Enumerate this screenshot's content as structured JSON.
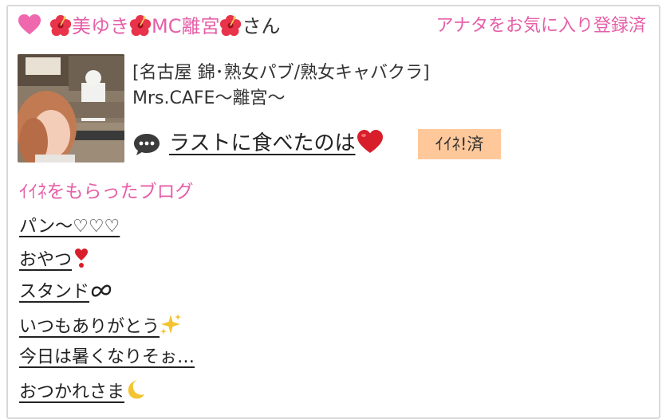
{
  "header": {
    "name_part1": "美ゆき",
    "name_part2": "MC離宮",
    "name_suffix": "さん",
    "favorite_status": "アナタをお気に入り登録済"
  },
  "shop": {
    "line1": "[名古屋 錦･熟女パブ/熟女キャバクラ]",
    "line2": "Mrs.CAFE〜離宮〜"
  },
  "post": {
    "title": "ラストに食べたのは",
    "like_badge": "ｲｲﾈ!済"
  },
  "section": {
    "title": "ｲｲﾈをもらったブログ"
  },
  "blogs": [
    {
      "text": "パン〜♡♡♡",
      "icon": ""
    },
    {
      "text": "おやつ",
      "icon": "exclamation-heart-icon"
    },
    {
      "text": "スタンド",
      "icon": "double-loop-icon"
    },
    {
      "text": "いつもありがとう",
      "icon": "sparkles-icon"
    },
    {
      "text": "今日は暑くなりそぉ…",
      "icon": ""
    },
    {
      "text": "おつかれさま",
      "icon": "crescent-moon-icon"
    }
  ],
  "colors": {
    "accent_pink": "#e65fa8",
    "badge_bg": "#ffc89b",
    "heart_red": "#d81e2a"
  }
}
